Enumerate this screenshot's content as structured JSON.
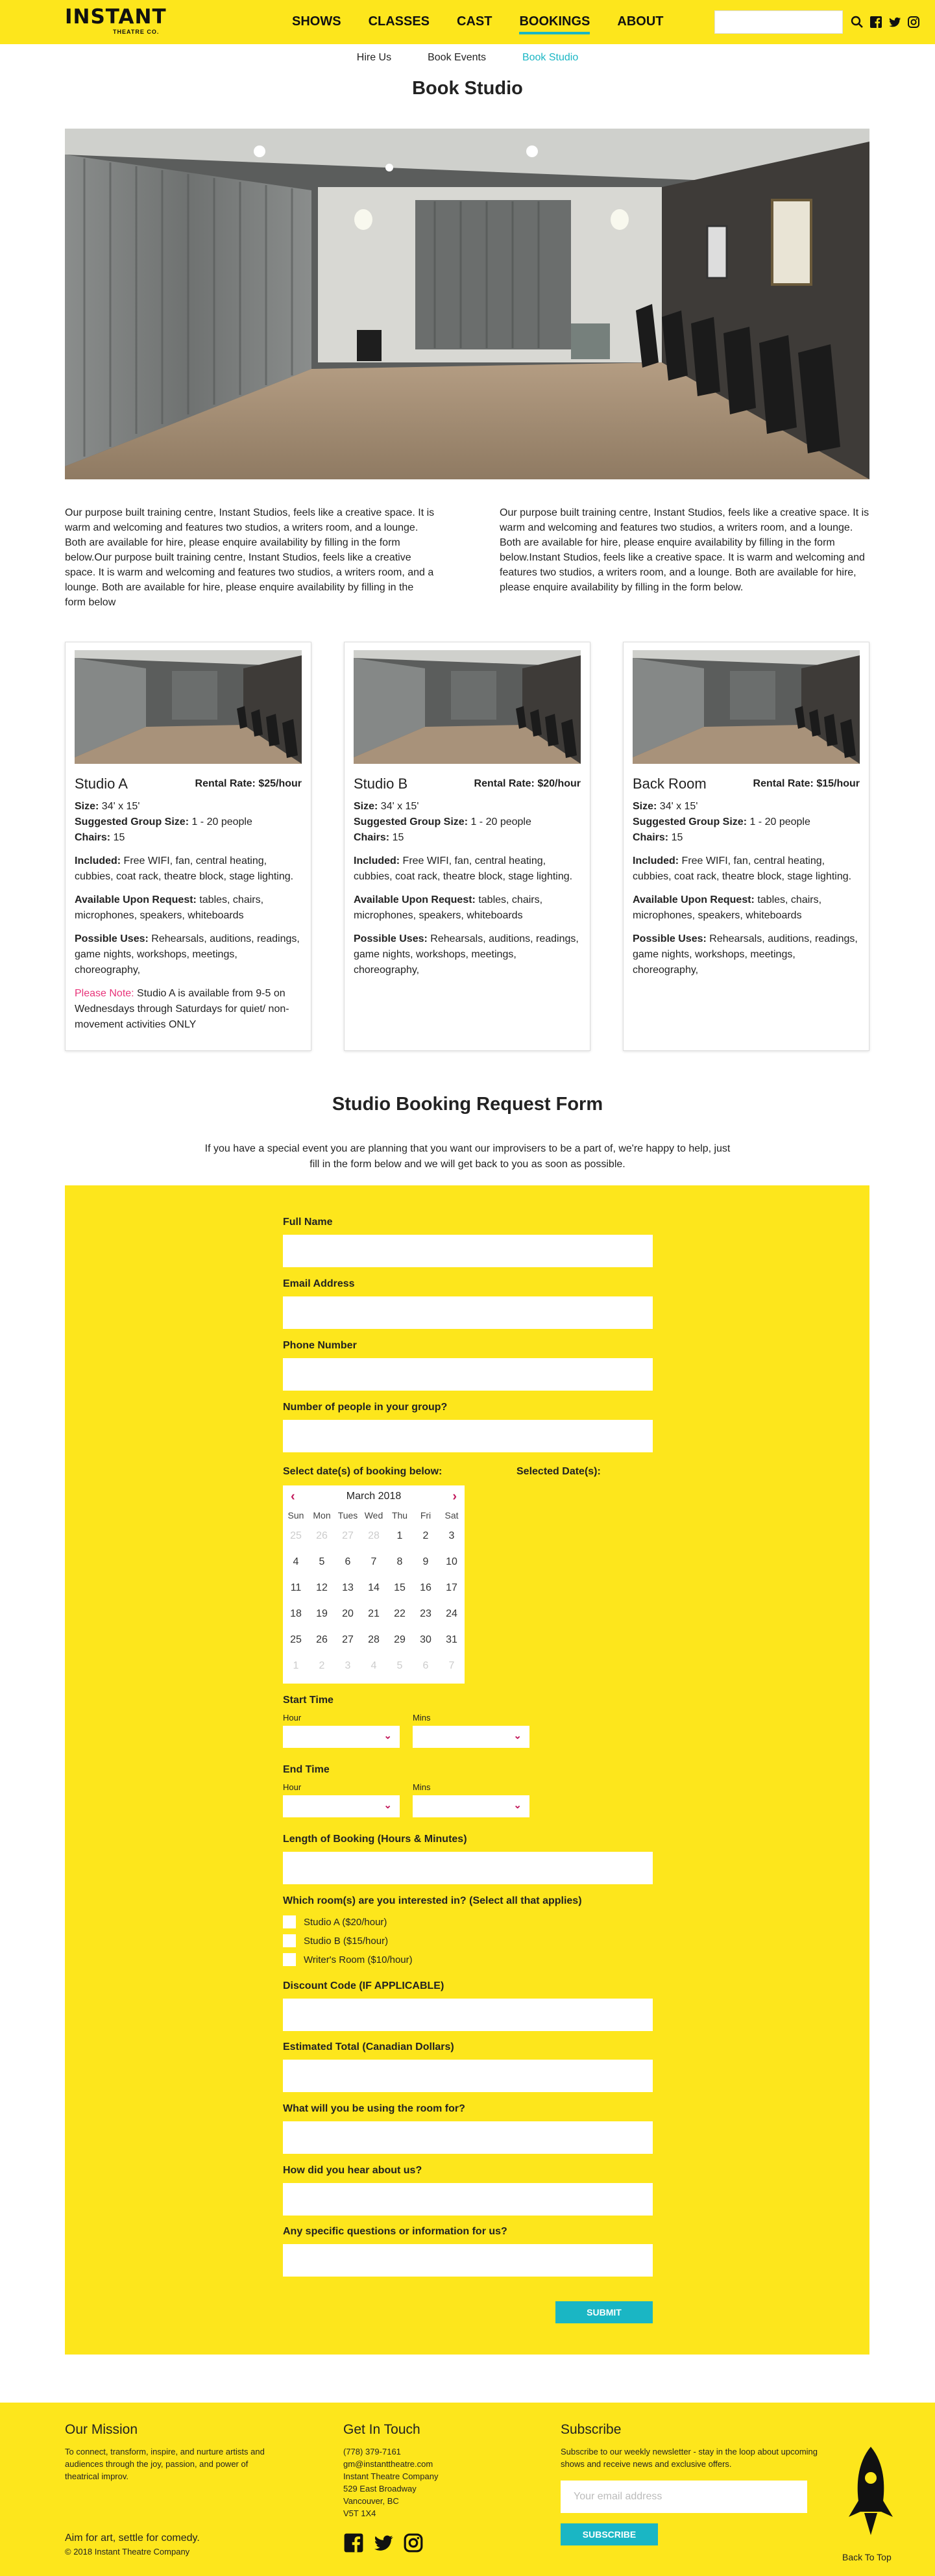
{
  "brand": {
    "logo_main": "INSTANT",
    "logo_sub": "THEATRE CO."
  },
  "nav": {
    "items": [
      {
        "label": "SHOWS"
      },
      {
        "label": "CLASSES"
      },
      {
        "label": "CAST"
      },
      {
        "label": "BOOKINGS",
        "active": true
      },
      {
        "label": "ABOUT"
      }
    ]
  },
  "subnav": {
    "items": [
      {
        "label": "Hire Us"
      },
      {
        "label": "Book Events"
      },
      {
        "label": "Book Studio",
        "active": true
      }
    ]
  },
  "page": {
    "title": "Book Studio"
  },
  "intro": {
    "left": "Our purpose built training centre, Instant Studios, feels like a creative space. It is warm and welcoming and features two studios, a writers room, and a lounge. Both are available for hire, please enquire availability by filling in the form below.Our purpose built training centre, Instant Studios, feels like a creative space. It is warm and welcoming and features two studios, a writers room, and a lounge. Both are available for hire, please enquire availability by filling in the form below",
    "right": "Our purpose built training centre, Instant Studios, feels like a creative space. It is warm and welcoming and features two studios, a writers room, and a lounge. Both are available for hire, please enquire availability by filling in the form below.Instant Studios, feels like a creative space. It is warm and welcoming and features two studios, a writers room, and a lounge. Both are available for hire, please enquire availability by filling in the form below."
  },
  "cards": [
    {
      "name": "Studio A",
      "rate": "Rental Rate: $25/hour",
      "size_label": "Size:",
      "size": " 34' x 15'",
      "group_label": "Suggested Group Size:",
      "group": " 1 - 20 people",
      "chairs_label": "Chairs:",
      "chairs": " 15",
      "included_label": "Included:",
      "included": " Free WIFI, fan, central heating, cubbies, coat rack, theatre block, stage lighting.",
      "request_label": "Available Upon Request:",
      "request": " tables, chairs, microphones, speakers, whiteboards",
      "uses_label": "Possible Uses:",
      "uses": " Rehearsals, auditions, readings, game nights, workshops, meetings, choreography,",
      "note_label": "Please Note:",
      "note": " Studio A is available from 9-5 on Wednesdays through Saturdays for quiet/ non-movement activities ONLY"
    },
    {
      "name": "Studio B",
      "rate": "Rental Rate: $20/hour",
      "size_label": "Size:",
      "size": " 34' x 15'",
      "group_label": "Suggested Group Size:",
      "group": " 1 - 20 people",
      "chairs_label": "Chairs:",
      "chairs": " 15",
      "included_label": "Included:",
      "included": " Free WIFI, fan, central heating, cubbies, coat rack, theatre block, stage lighting.",
      "request_label": "Available Upon Request:",
      "request": " tables, chairs, microphones, speakers, whiteboards",
      "uses_label": "Possible Uses:",
      "uses": " Rehearsals, auditions, readings, game nights, workshops, meetings, choreography,"
    },
    {
      "name": "Back Room",
      "rate": "Rental Rate: $15/hour",
      "size_label": "Size:",
      "size": " 34' x 15'",
      "group_label": "Suggested Group Size:",
      "group": " 1 - 20 people",
      "chairs_label": "Chairs:",
      "chairs": " 15",
      "included_label": "Included:",
      "included": " Free WIFI, fan, central heating, cubbies, coat rack, theatre block, stage lighting.",
      "request_label": "Available Upon Request:",
      "request": " tables, chairs, microphones, speakers, whiteboards",
      "uses_label": "Possible Uses:",
      "uses": " Rehearsals, auditions, readings, game nights, workshops, meetings, choreography,"
    }
  ],
  "form": {
    "title": "Studio Booking Request Form",
    "intro": "If you have a special event you are planning that you want our improvisers to be a part of, we're happy to help, just fill in the form below and we will get back to you as soon as possible.",
    "full_name": "Full Name",
    "email": "Email Address",
    "phone": "Phone Number",
    "people": "Number of people in your group?",
    "select_dates": "Select date(s) of booking below:",
    "selected_dates": "Selected Date(s):",
    "calendar": {
      "month": "March 2018",
      "dow": [
        "Sun",
        "Mon",
        "Tues",
        "Wed",
        "Thu",
        "Fri",
        "Sat"
      ],
      "days": [
        "25",
        "26",
        "27",
        "28",
        "1",
        "2",
        "3",
        "4",
        "5",
        "6",
        "7",
        "8",
        "9",
        "10",
        "11",
        "12",
        "13",
        "14",
        "15",
        "16",
        "17",
        "18",
        "19",
        "20",
        "21",
        "22",
        "23",
        "24",
        "25",
        "26",
        "27",
        "28",
        "29",
        "30",
        "31",
        "1",
        "2",
        "3",
        "4",
        "5",
        "6",
        "7"
      ]
    },
    "start_time": "Start Time",
    "end_time": "End Time",
    "hour": "Hour",
    "mins": "Mins",
    "length": "Length of Booking (Hours & Minutes)",
    "rooms_q": "Which room(s) are you interested in? (Select all that applies)",
    "rooms": [
      "Studio A ($20/hour)",
      "Studio B ($15/hour)",
      "Writer's Room ($10/hour)"
    ],
    "discount": "Discount Code (IF APPLICABLE)",
    "total": "Estimated Total (Canadian Dollars)",
    "use": "What will you be using the room for?",
    "hear": "How did you hear about us?",
    "questions": "Any specific questions or information for us?",
    "submit": "SUBMIT"
  },
  "footer": {
    "mission_title": "Our Mission",
    "mission": "To connect, transform, inspire, and nurture artists and audiences through the joy, passion, and power of theatrical improv.",
    "contact_title": "Get In Touch",
    "contact": [
      "(778) 379-7161",
      "gm@instanttheatre.com",
      "Instant Theatre Company",
      "529 East Broadway",
      "Vancouver, BC",
      "V5T 1X4"
    ],
    "subscribe_title": "Subscribe",
    "subscribe": "Subscribe to our weekly newsletter - stay in the loop about upcoming shows and receive news and exclusive offers.",
    "email_placeholder": "Your email address",
    "subscribe_btn": "SUBSCRIBE",
    "tagline": "Aim for art, settle for comedy.",
    "copyright": "© 2018 Instant Theatre Company",
    "back_to_top": "Back To Top"
  },
  "colors": {
    "brand_yellow": "#fde61c",
    "accent_teal": "#1ab6c4",
    "accent_pink": "#e8347a"
  }
}
